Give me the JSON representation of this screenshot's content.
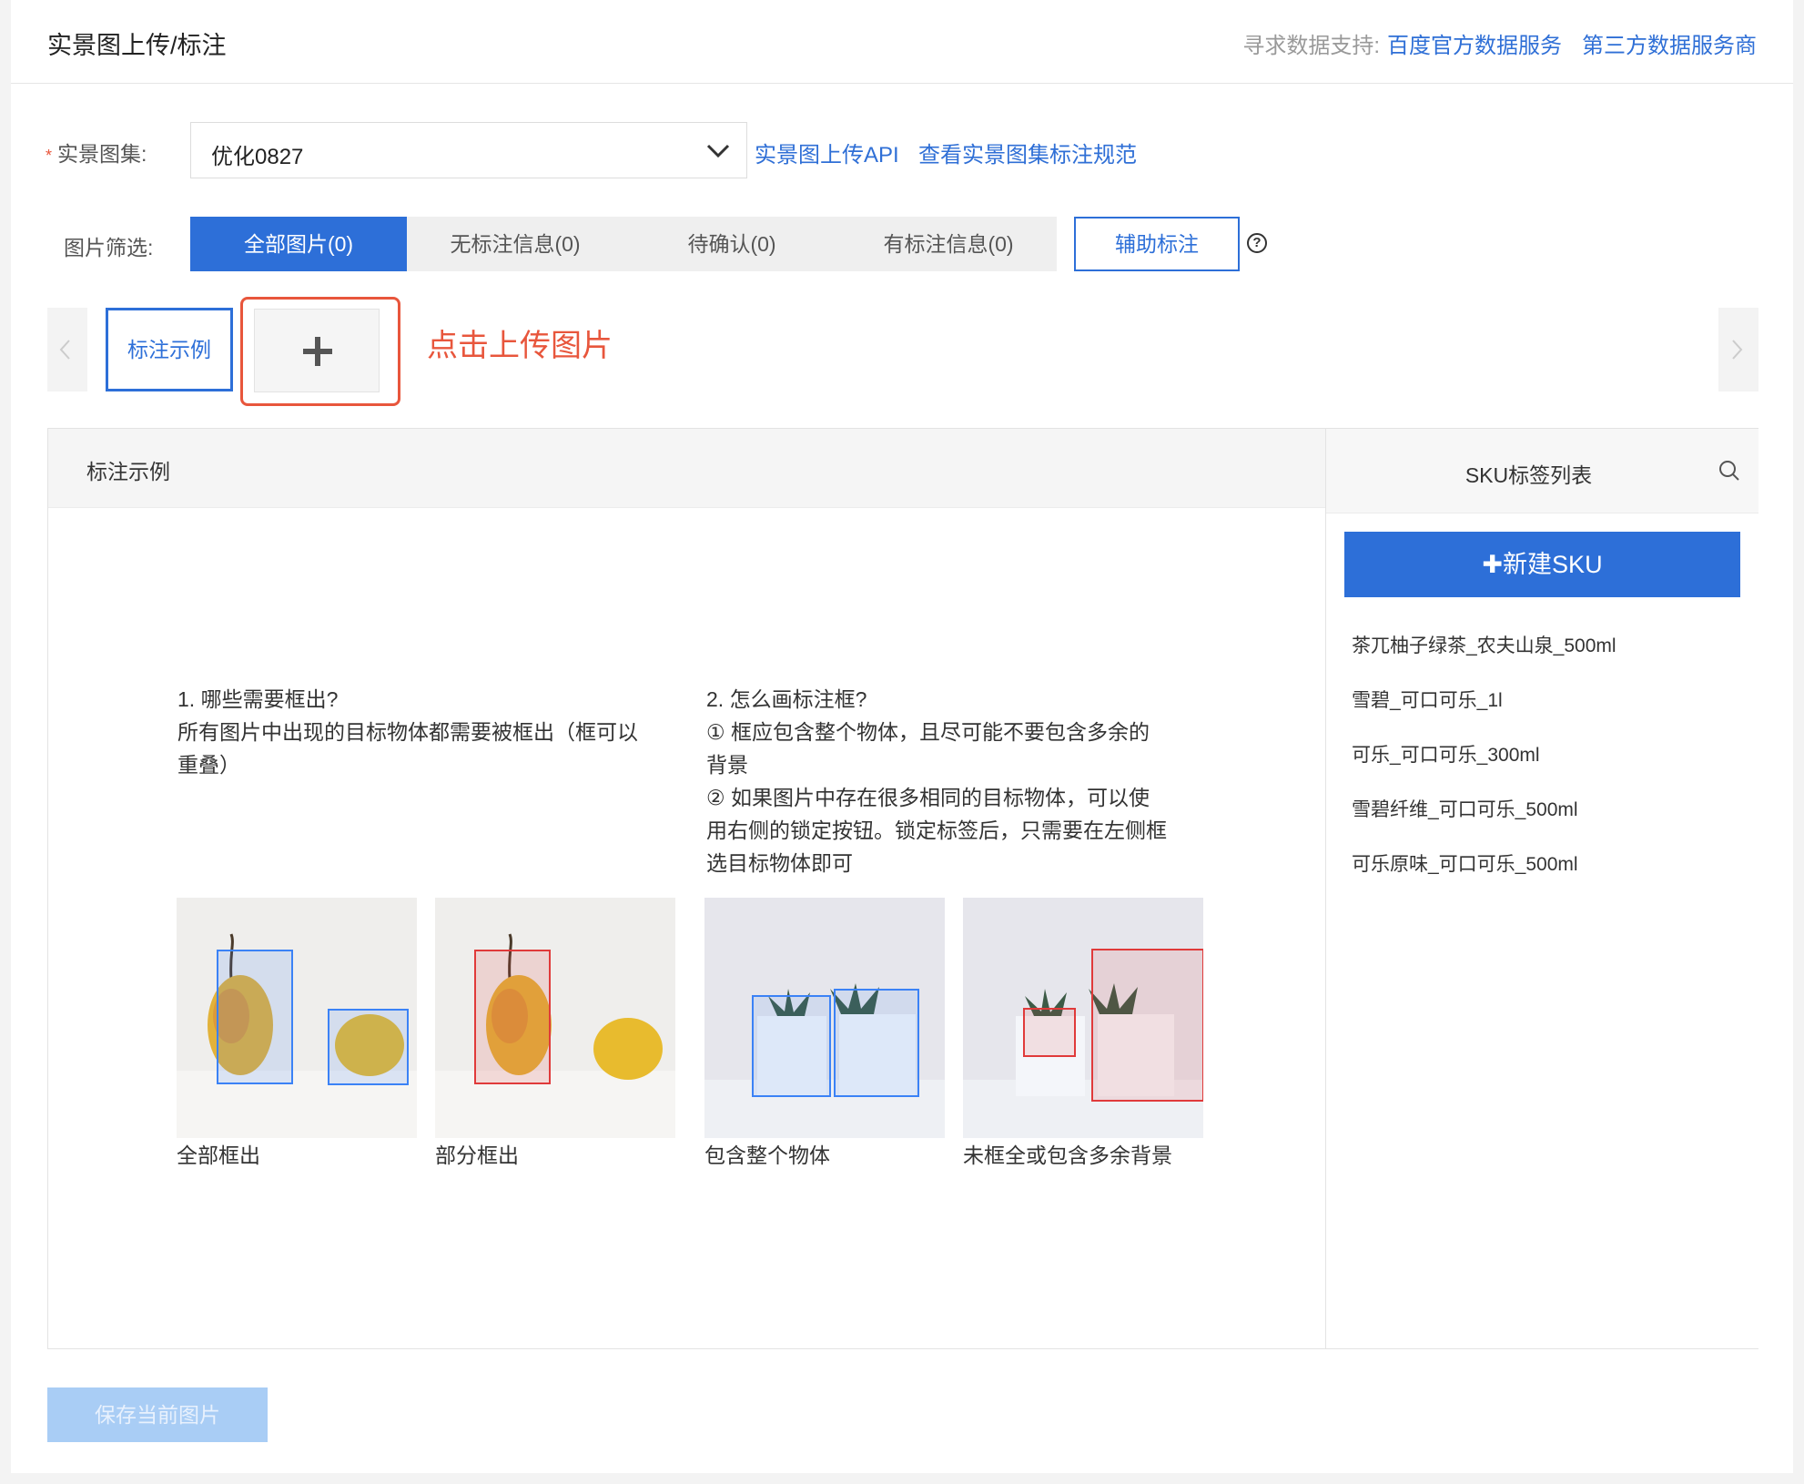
{
  "header": {
    "title": "实景图上传/标注",
    "support_label": "寻求数据支持:",
    "links": [
      "百度官方数据服务",
      "第三方数据服务商"
    ]
  },
  "form": {
    "set_label": "实景图集:",
    "required_mark": "*",
    "set_value": "优化0827",
    "links": [
      "实景图上传API",
      "查看实景图集标注规范"
    ],
    "filter_label": "图片筛选:",
    "filters": [
      "全部图片(0)",
      "无标注信息(0)",
      "待确认(0)",
      "有标注信息(0)"
    ],
    "assist_label": "辅助标注",
    "help_glyph": "?"
  },
  "strip": {
    "example_label": "标注示例",
    "upload_hint": "点击上传图片"
  },
  "panel": {
    "title": "标注示例",
    "guide1": {
      "title": "1. 哪些需要框出?",
      "lines": [
        "所有图片中出现的目标物体都需要被框出（框可以",
        "重叠）"
      ]
    },
    "guide2": {
      "title": "2. 怎么画标注框?",
      "lines": [
        "① 框应包含整个物体，且尽可能不要包含多余的",
        "背景",
        "② 如果图片中存在很多相同的目标物体，可以使",
        "用右侧的锁定按钮。锁定标签后，只需要在左侧框",
        "选目标物体即可"
      ]
    },
    "captions": [
      "全部框出",
      "部分框出",
      "包含整个物体",
      "未框全或包含多余背景"
    ]
  },
  "sku": {
    "title": "SKU标签列表",
    "new_label": "新建SKU",
    "items": [
      "茶兀柚子绿茶_农夫山泉_500ml",
      "雪碧_可口可乐_1l",
      "可乐_可口可乐_300ml",
      "雪碧纤维_可口可乐_500ml",
      "可乐原味_可口可乐_500ml"
    ]
  },
  "footer": {
    "save_label": "保存当前图片"
  },
  "colors": {
    "accent": "#2d6fd8",
    "hint": "#e8563c",
    "box_blue": "#3b82f6",
    "box_red": "#e03a3a"
  }
}
